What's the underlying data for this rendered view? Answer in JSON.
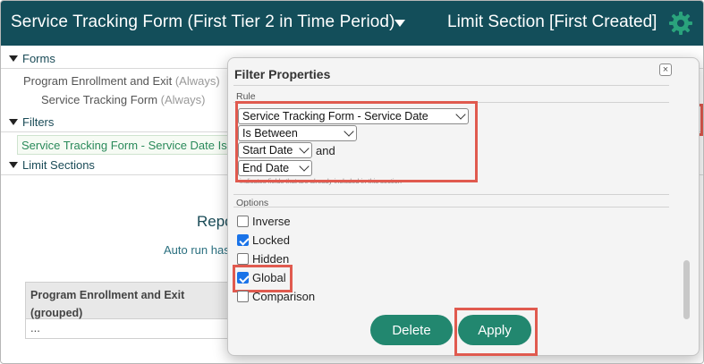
{
  "header": {
    "title": "Service Tracking Form (First Tier 2 in Time Period)",
    "limit_section": "Limit Section [First Created]",
    "color": "#134e5a"
  },
  "tree": {
    "forms_label": "Forms",
    "forms": [
      {
        "name": "Program Enrollment and Exit",
        "qualifier": "(Always)"
      },
      {
        "name": "Service Tracking Form",
        "qualifier": "(Always)"
      }
    ],
    "filters_label": "Filters",
    "filter_item": "Service Tracking Form - Service Date Is Between",
    "limit_sections_label": "Limit Sections"
  },
  "report": {
    "title": "Repo",
    "auto_run": "Auto run has",
    "grid_header": "Program Enrollment and Exit (grouped)",
    "grid_row": "..."
  },
  "dialog": {
    "title": "Filter Properties",
    "close": "×",
    "rule_label": "Rule",
    "field": "Service Tracking Form - Service Date",
    "operator": "Is Between",
    "start": "Start Date",
    "and": "and",
    "end": "End Date",
    "note": "* indicates fields that are already included in this section",
    "options_label": "Options",
    "options": [
      {
        "label": "Inverse",
        "checked": false
      },
      {
        "label": "Locked",
        "checked": true
      },
      {
        "label": "Hidden",
        "checked": false
      },
      {
        "label": "Global",
        "checked": true
      },
      {
        "label": "Comparison",
        "checked": false
      }
    ],
    "delete_label": "Delete",
    "apply_label": "Apply"
  },
  "accent": {
    "highlight": "#e05a4f",
    "button": "#22876f"
  }
}
